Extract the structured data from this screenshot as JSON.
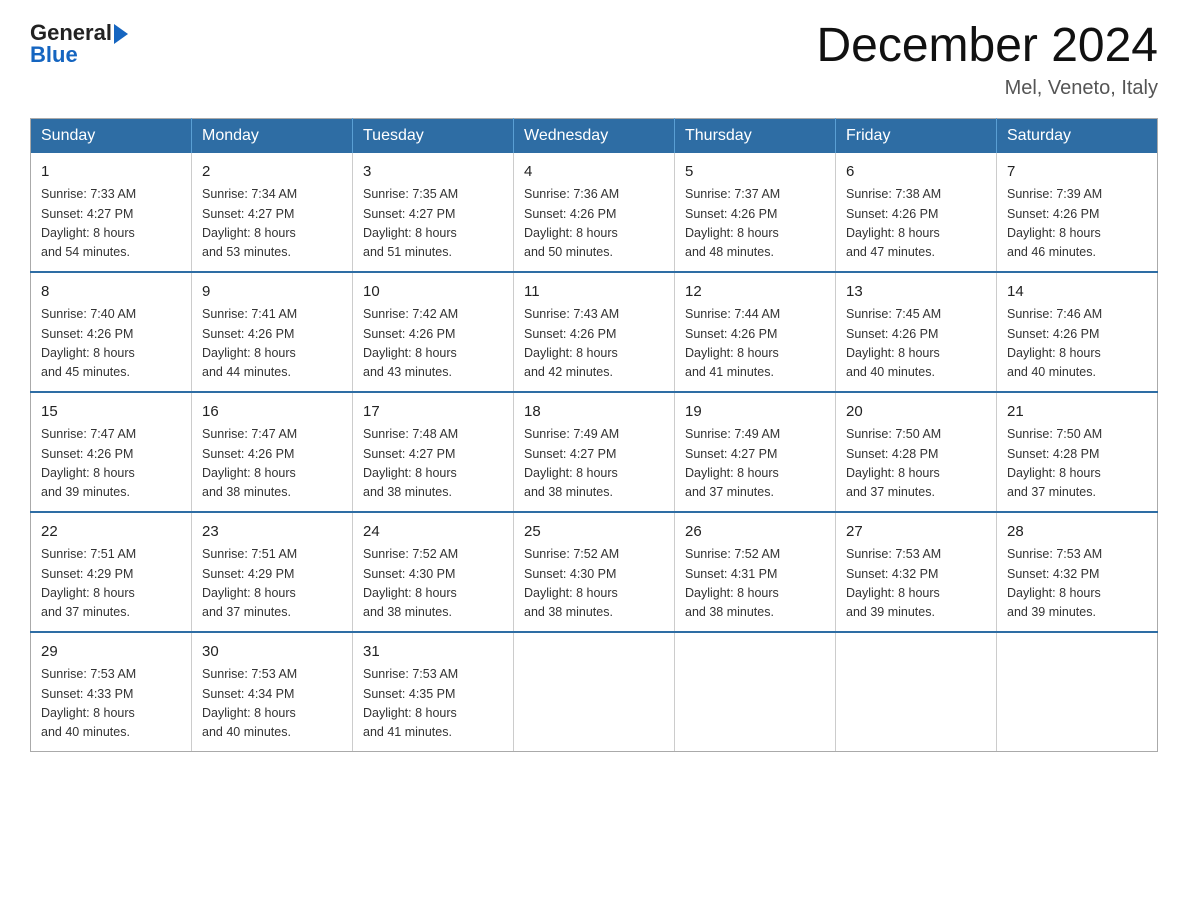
{
  "logo": {
    "general": "General",
    "blue": "Blue"
  },
  "title": "December 2024",
  "location": "Mel, Veneto, Italy",
  "days_of_week": [
    "Sunday",
    "Monday",
    "Tuesday",
    "Wednesday",
    "Thursday",
    "Friday",
    "Saturday"
  ],
  "weeks": [
    [
      {
        "day": "1",
        "sunrise": "7:33 AM",
        "sunset": "4:27 PM",
        "daylight": "8 hours and 54 minutes."
      },
      {
        "day": "2",
        "sunrise": "7:34 AM",
        "sunset": "4:27 PM",
        "daylight": "8 hours and 53 minutes."
      },
      {
        "day": "3",
        "sunrise": "7:35 AM",
        "sunset": "4:27 PM",
        "daylight": "8 hours and 51 minutes."
      },
      {
        "day": "4",
        "sunrise": "7:36 AM",
        "sunset": "4:26 PM",
        "daylight": "8 hours and 50 minutes."
      },
      {
        "day": "5",
        "sunrise": "7:37 AM",
        "sunset": "4:26 PM",
        "daylight": "8 hours and 48 minutes."
      },
      {
        "day": "6",
        "sunrise": "7:38 AM",
        "sunset": "4:26 PM",
        "daylight": "8 hours and 47 minutes."
      },
      {
        "day": "7",
        "sunrise": "7:39 AM",
        "sunset": "4:26 PM",
        "daylight": "8 hours and 46 minutes."
      }
    ],
    [
      {
        "day": "8",
        "sunrise": "7:40 AM",
        "sunset": "4:26 PM",
        "daylight": "8 hours and 45 minutes."
      },
      {
        "day": "9",
        "sunrise": "7:41 AM",
        "sunset": "4:26 PM",
        "daylight": "8 hours and 44 minutes."
      },
      {
        "day": "10",
        "sunrise": "7:42 AM",
        "sunset": "4:26 PM",
        "daylight": "8 hours and 43 minutes."
      },
      {
        "day": "11",
        "sunrise": "7:43 AM",
        "sunset": "4:26 PM",
        "daylight": "8 hours and 42 minutes."
      },
      {
        "day": "12",
        "sunrise": "7:44 AM",
        "sunset": "4:26 PM",
        "daylight": "8 hours and 41 minutes."
      },
      {
        "day": "13",
        "sunrise": "7:45 AM",
        "sunset": "4:26 PM",
        "daylight": "8 hours and 40 minutes."
      },
      {
        "day": "14",
        "sunrise": "7:46 AM",
        "sunset": "4:26 PM",
        "daylight": "8 hours and 40 minutes."
      }
    ],
    [
      {
        "day": "15",
        "sunrise": "7:47 AM",
        "sunset": "4:26 PM",
        "daylight": "8 hours and 39 minutes."
      },
      {
        "day": "16",
        "sunrise": "7:47 AM",
        "sunset": "4:26 PM",
        "daylight": "8 hours and 38 minutes."
      },
      {
        "day": "17",
        "sunrise": "7:48 AM",
        "sunset": "4:27 PM",
        "daylight": "8 hours and 38 minutes."
      },
      {
        "day": "18",
        "sunrise": "7:49 AM",
        "sunset": "4:27 PM",
        "daylight": "8 hours and 38 minutes."
      },
      {
        "day": "19",
        "sunrise": "7:49 AM",
        "sunset": "4:27 PM",
        "daylight": "8 hours and 37 minutes."
      },
      {
        "day": "20",
        "sunrise": "7:50 AM",
        "sunset": "4:28 PM",
        "daylight": "8 hours and 37 minutes."
      },
      {
        "day": "21",
        "sunrise": "7:50 AM",
        "sunset": "4:28 PM",
        "daylight": "8 hours and 37 minutes."
      }
    ],
    [
      {
        "day": "22",
        "sunrise": "7:51 AM",
        "sunset": "4:29 PM",
        "daylight": "8 hours and 37 minutes."
      },
      {
        "day": "23",
        "sunrise": "7:51 AM",
        "sunset": "4:29 PM",
        "daylight": "8 hours and 37 minutes."
      },
      {
        "day": "24",
        "sunrise": "7:52 AM",
        "sunset": "4:30 PM",
        "daylight": "8 hours and 38 minutes."
      },
      {
        "day": "25",
        "sunrise": "7:52 AM",
        "sunset": "4:30 PM",
        "daylight": "8 hours and 38 minutes."
      },
      {
        "day": "26",
        "sunrise": "7:52 AM",
        "sunset": "4:31 PM",
        "daylight": "8 hours and 38 minutes."
      },
      {
        "day": "27",
        "sunrise": "7:53 AM",
        "sunset": "4:32 PM",
        "daylight": "8 hours and 39 minutes."
      },
      {
        "day": "28",
        "sunrise": "7:53 AM",
        "sunset": "4:32 PM",
        "daylight": "8 hours and 39 minutes."
      }
    ],
    [
      {
        "day": "29",
        "sunrise": "7:53 AM",
        "sunset": "4:33 PM",
        "daylight": "8 hours and 40 minutes."
      },
      {
        "day": "30",
        "sunrise": "7:53 AM",
        "sunset": "4:34 PM",
        "daylight": "8 hours and 40 minutes."
      },
      {
        "day": "31",
        "sunrise": "7:53 AM",
        "sunset": "4:35 PM",
        "daylight": "8 hours and 41 minutes."
      },
      null,
      null,
      null,
      null
    ]
  ],
  "labels": {
    "sunrise": "Sunrise:",
    "sunset": "Sunset:",
    "daylight": "Daylight:"
  }
}
